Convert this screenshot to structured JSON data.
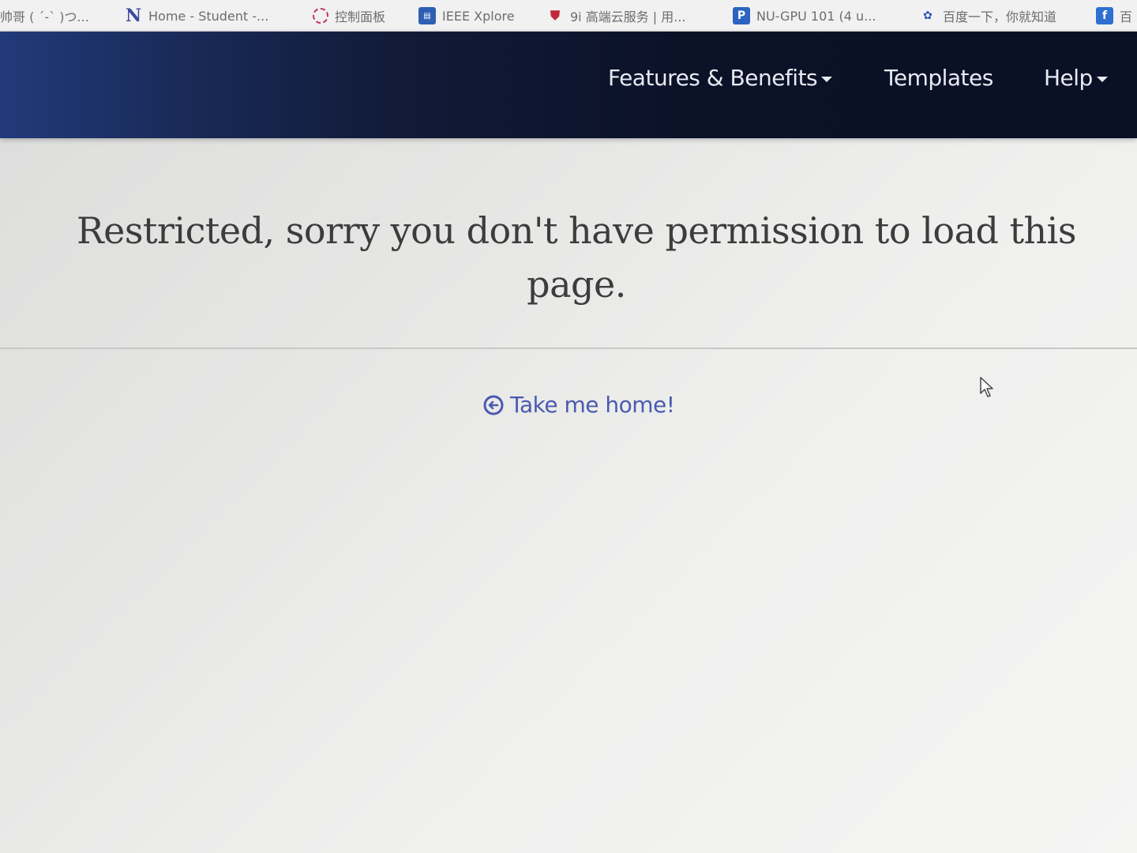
{
  "bookmarks": [
    {
      "icon": "tab-fragment-icon",
      "label": "帅哥 ( ´-` )つ..."
    },
    {
      "icon": "n-letter-icon",
      "label": "Home - Student -..."
    },
    {
      "icon": "control-panel-icon",
      "label": "控制面板"
    },
    {
      "icon": "ieee-icon",
      "label": "IEEE Xplore"
    },
    {
      "icon": "shield-icon",
      "label": "9i 高端云服务 | 用..."
    },
    {
      "icon": "p-letter-icon",
      "label": "NU-GPU 101 (4 u..."
    },
    {
      "icon": "baidu-paw-icon",
      "label": "百度一下，你就知道"
    },
    {
      "icon": "f-letter-icon",
      "label": "百"
    }
  ],
  "navbar": {
    "features_label": "Features & Benefits",
    "templates_label": "Templates",
    "help_label": "Help"
  },
  "main": {
    "heading": "Restricted, sorry you don't have permission to load this page.",
    "home_link_label": "Take me home!"
  },
  "colors": {
    "navbar_dark": "#0b1228",
    "navbar_accent": "#223a7a",
    "link": "#4a5ab0",
    "heading": "#3c3c3c"
  }
}
